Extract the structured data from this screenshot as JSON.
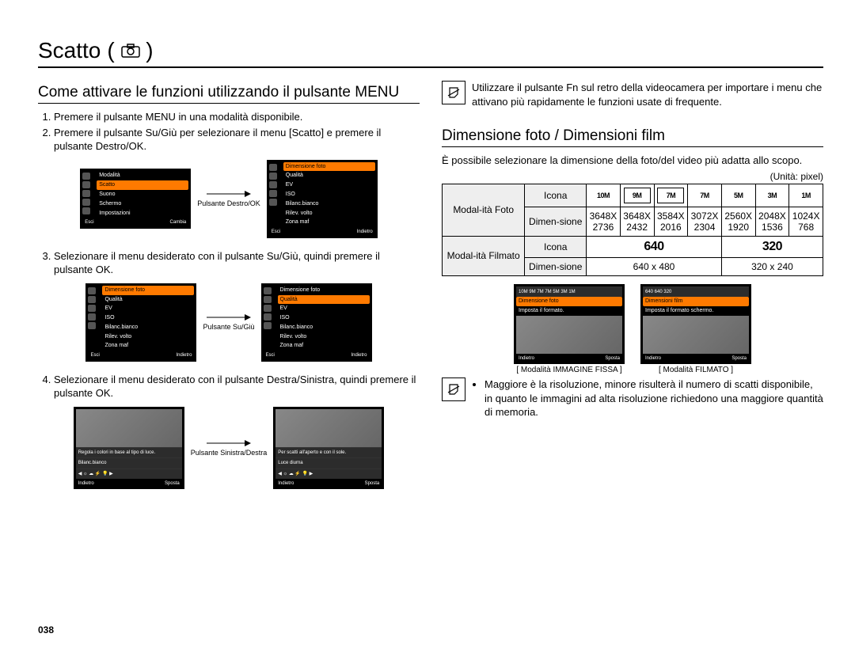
{
  "title": "Scatto",
  "left": {
    "section_title": "Come attivare le funzioni utilizzando il pulsante MENU",
    "steps": [
      "Premere il pulsante MENU in una modalità disponibile.",
      "Premere il pulsante Su/Giù per selezionare il menu [Scatto] e premere il pulsante Destro/OK.",
      "Selezionare il menu desiderato con il pulsante Su/Giù, quindi premere il pulsante OK.",
      "Selezionare il menu desiderato con il pulsante Destra/Sinistra, quindi premere il pulsante OK."
    ],
    "arrow1": "Pulsante Destro/OK",
    "arrow2": "Pulsante Su/Giù",
    "arrow3": "Pulsante Sinistra/Destra",
    "menu_left": [
      "Modalità",
      "Scatto",
      "Suono",
      "Schermo",
      "Impostazioni"
    ],
    "menu_right": [
      "Dimensione foto",
      "Qualità",
      "EV",
      "ISO",
      "Bilanc.bianco",
      "Rilev. volto",
      "Zona maf"
    ],
    "menu2_right_label": "Qualità",
    "wb_line1": "Regola i colori in base al tipo di luce.",
    "wb_line2": "Bilanc.bianco",
    "wb_line3": "Per scatti all'aperto e con il sole.",
    "wb_line4": "Luce diurna",
    "footer_left": "Esci",
    "footer_mid": "Cambia",
    "footer_right": "Indietro",
    "footer_sposta": "Sposta"
  },
  "right": {
    "note_top": "Utilizzare il pulsante Fn sul retro della videocamera per importare i menu che attivano più rapidamente le funzioni usate di frequente.",
    "section_title": "Dimensione foto / Dimensioni film",
    "intro": "È possibile selezionare la dimensione della foto/del video più adatta allo scopo.",
    "unit_label": "(Unità: pixel)",
    "tbl": {
      "row_photo": "Modal-ità Foto",
      "row_film": "Modal-ità Filmato",
      "icona": "Icona",
      "dimen": "Dimen-sione",
      "photo_icons": [
        "10M",
        "9M",
        "7M",
        "7M",
        "5M",
        "3M",
        "1M"
      ],
      "photo_dims_top": [
        "3648X",
        "3648X",
        "3584X",
        "3072X",
        "2560X",
        "2048X",
        "1024X"
      ],
      "photo_dims_bot": [
        "2736",
        "2432",
        "2016",
        "2304",
        "1920",
        "1536",
        "768"
      ],
      "film_icons": [
        "640",
        "320"
      ],
      "film_dims": [
        "640 x 480",
        "320 x 240"
      ]
    },
    "thumbA": {
      "top_icons": "10M 9M 7M 7M 5M 3M 1M",
      "line1": "Dimensione foto",
      "line2": "Imposta il formato.",
      "cap": "[ Modalità IMMAGINE FISSA ]"
    },
    "thumbB": {
      "top_icons": "640 640 320",
      "line1": "Dimensioni film",
      "line2": "Imposta il formato schermo.",
      "cap": "[ Modalità FILMATO ]"
    },
    "note_bottom": "Maggiore è la risoluzione, minore risulterà il numero di scatti disponibile, in quanto le immagini ad alta risoluzione richiedono una maggiore quantità di memoria."
  },
  "page_num": "038"
}
